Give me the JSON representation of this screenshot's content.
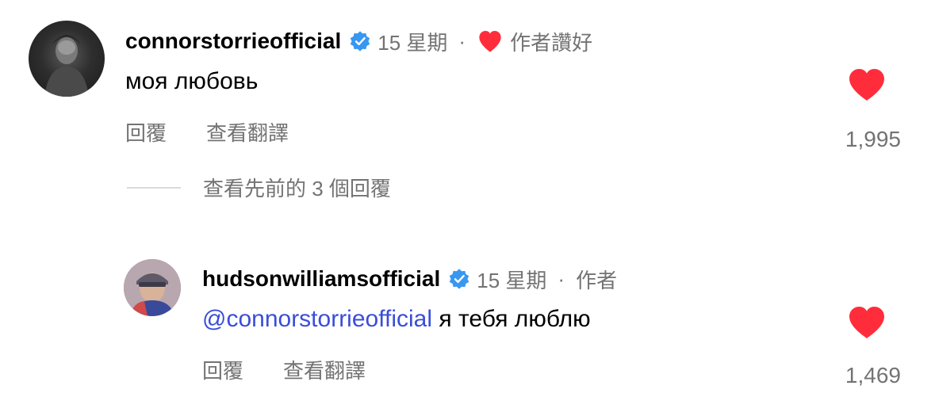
{
  "comments": [
    {
      "username": "connorstorrieofficial",
      "time": "15 星期",
      "author_liked": "作者讚好",
      "text": "моя любовь",
      "reply_label": "回覆",
      "translate_label": "查看翻譯",
      "like_count": "1,995",
      "avatar_icon": "avatar-portrait",
      "verified_color": "#3897f0",
      "heart_color": "#ff2d3b"
    }
  ],
  "view_previous_replies": "查看先前的 3 個回覆",
  "reply": {
    "username": "hudsonwilliamsofficial",
    "time": "15 星期",
    "author_tag": "作者",
    "mention": "@connorstorrieofficial",
    "text": "я тебя люблю",
    "reply_label": "回覆",
    "translate_label": "查看翻譯",
    "like_count": "1,469",
    "mention_color": "#3a4dd8"
  }
}
